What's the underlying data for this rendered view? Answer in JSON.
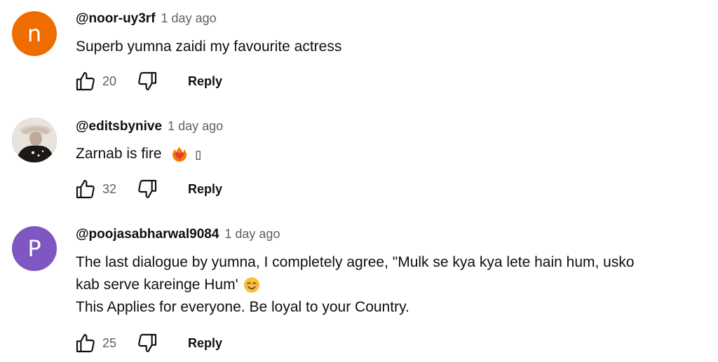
{
  "comments": [
    {
      "avatar_letter": "n",
      "avatar_color": "#ef6c00",
      "author": "@noor-uy3rf",
      "time": "1 day ago",
      "text_lines": [
        "Superb yumna zaidi my favourite actress"
      ],
      "likes": "20",
      "reply_label": "Reply"
    },
    {
      "avatar_letter": "",
      "avatar_color": "#2b2623",
      "author": "@editsbynive",
      "time": "1 day ago",
      "text_lines": [
        "Zarnab is fire"
      ],
      "trailing_glyph": "▯",
      "likes": "32",
      "reply_label": "Reply"
    },
    {
      "avatar_letter": "P",
      "avatar_color": "#7e57c2",
      "author": "@poojasabharwal9084",
      "time": "1 day ago",
      "text_lines": [
        "The last dialogue by yumna, I completely agree, \"Mulk se kya kya lete hain hum, usko",
        "kab serve kareinge Hum'",
        "This Applies for everyone. Be loyal to your Country."
      ],
      "likes": "25",
      "reply_label": "Reply"
    }
  ],
  "colors": {
    "text_primary": "#0f0f0f",
    "text_secondary": "#606060"
  }
}
